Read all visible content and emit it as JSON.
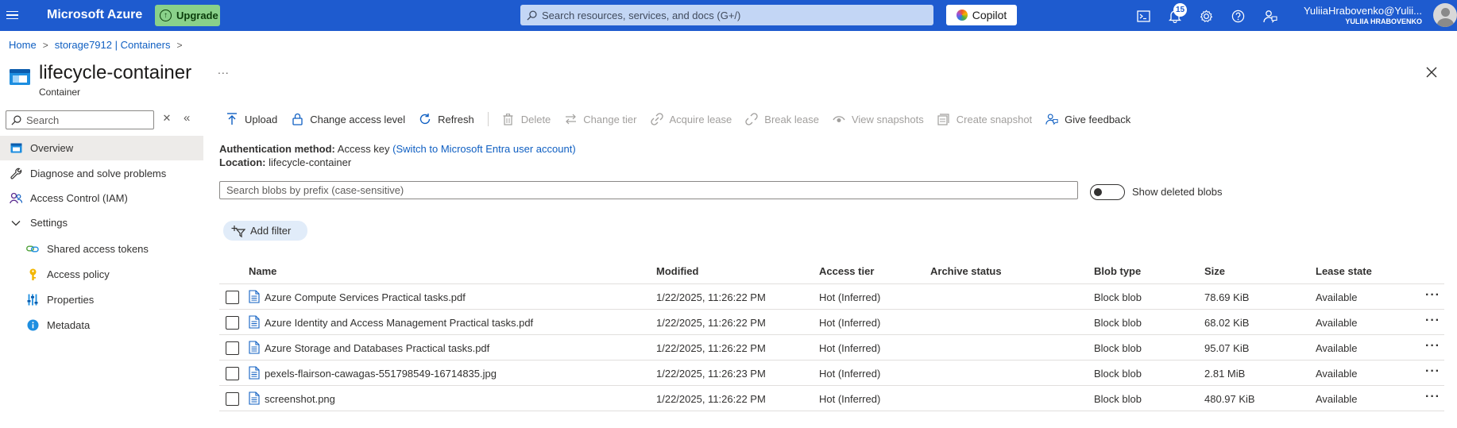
{
  "topbar": {
    "brand": "Microsoft Azure",
    "upgrade_label": "Upgrade",
    "search_placeholder": "Search resources, services, and docs (G+/)",
    "copilot_label": "Copilot",
    "notifications_count": "15",
    "user_email": "YuliiaHrabovenko@Yulii...",
    "user_directory": "YULIIA HRABOVENKO"
  },
  "breadcrumb": {
    "home": "Home",
    "parent": "storage7912 | Containers"
  },
  "resource": {
    "title": "lifecycle-container",
    "type": "Container",
    "more": "..."
  },
  "nav": {
    "search_placeholder": "Search",
    "items": [
      {
        "label": "Overview",
        "icon": "container-icon"
      },
      {
        "label": "Diagnose and solve problems",
        "icon": "wrench-icon"
      },
      {
        "label": "Access Control (IAM)",
        "icon": "people-icon"
      },
      {
        "label": "Settings",
        "icon": "chevron-down-icon"
      },
      {
        "label": "Shared access tokens",
        "icon": "link-icon"
      },
      {
        "label": "Access policy",
        "icon": "key-icon"
      },
      {
        "label": "Properties",
        "icon": "sliders-icon"
      },
      {
        "label": "Metadata",
        "icon": "info-icon"
      }
    ]
  },
  "commands": {
    "upload": "Upload",
    "change_access_level": "Change access level",
    "refresh": "Refresh",
    "delete": "Delete",
    "change_tier": "Change tier",
    "acquire_lease": "Acquire lease",
    "break_lease": "Break lease",
    "view_snapshots": "View snapshots",
    "create_snapshot": "Create snapshot",
    "give_feedback": "Give feedback"
  },
  "info": {
    "auth_label": "Authentication method:",
    "auth_value": "Access key",
    "auth_link": "(Switch to Microsoft Entra user account)",
    "location_label": "Location:",
    "location_value": "lifecycle-container"
  },
  "blob_search_placeholder": "Search blobs by prefix (case-sensitive)",
  "show_deleted_label": "Show deleted blobs",
  "show_deleted_on": false,
  "add_filter_label": "Add filter",
  "table": {
    "columns": [
      "Name",
      "Modified",
      "Access tier",
      "Archive status",
      "Blob type",
      "Size",
      "Lease state"
    ],
    "rows": [
      {
        "name": "Azure Compute Services Practical tasks.pdf",
        "modified": "1/22/2025, 11:26:22 PM",
        "tier": "Hot (Inferred)",
        "archive": "",
        "type": "Block blob",
        "size": "78.69 KiB",
        "lease": "Available"
      },
      {
        "name": "Azure Identity and Access Management Practical tasks.pdf",
        "modified": "1/22/2025, 11:26:22 PM",
        "tier": "Hot (Inferred)",
        "archive": "",
        "type": "Block blob",
        "size": "68.02 KiB",
        "lease": "Available"
      },
      {
        "name": "Azure Storage and Databases Practical tasks.pdf",
        "modified": "1/22/2025, 11:26:22 PM",
        "tier": "Hot (Inferred)",
        "archive": "",
        "type": "Block blob",
        "size": "95.07 KiB",
        "lease": "Available"
      },
      {
        "name": "pexels-flairson-cawagas-551798549-16714835.jpg",
        "modified": "1/22/2025, 11:26:23 PM",
        "tier": "Hot (Inferred)",
        "archive": "",
        "type": "Block blob",
        "size": "2.81 MiB",
        "lease": "Available"
      },
      {
        "name": "screenshot.png",
        "modified": "1/22/2025, 11:26:22 PM",
        "tier": "Hot (Inferred)",
        "archive": "",
        "type": "Block blob",
        "size": "480.97 KiB",
        "lease": "Available"
      }
    ]
  },
  "colors": {
    "topbar": "#1e5bcf",
    "link": "#0f5fc2",
    "upgrade": "#8ad18a"
  }
}
